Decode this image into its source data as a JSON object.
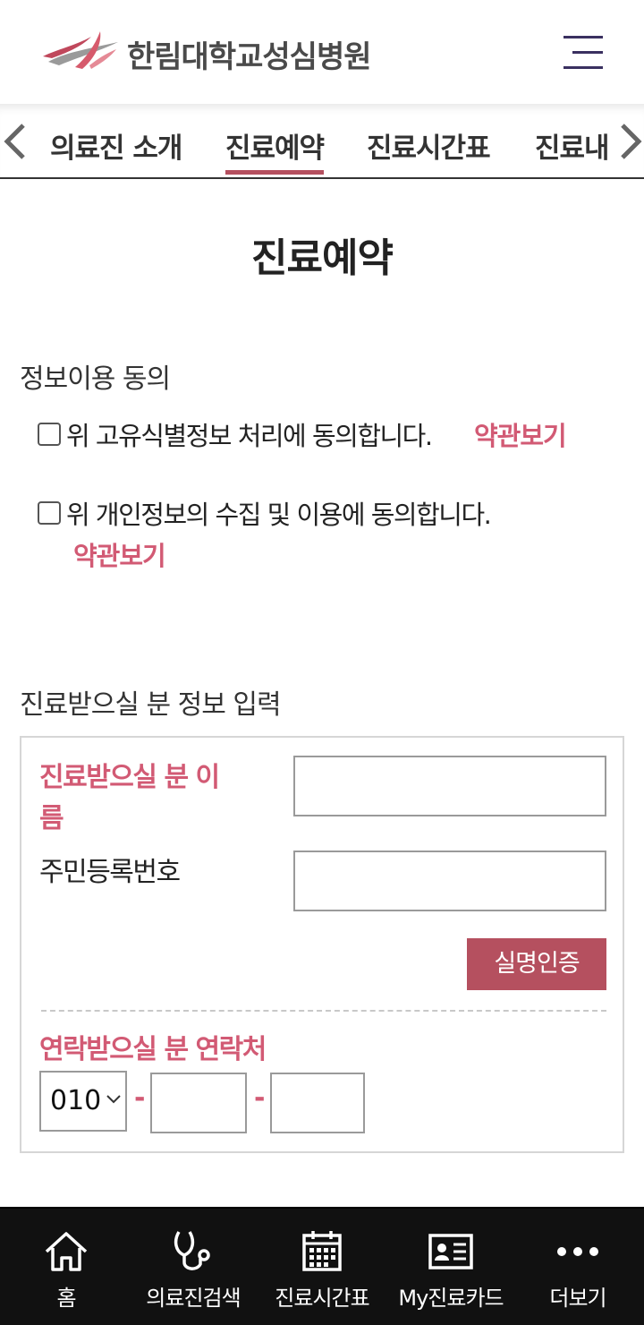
{
  "header": {
    "hospital_name": "한림대학교성심병원",
    "logo_icon": "hallym-logo-icon",
    "menu_icon": "hamburger-menu-icon"
  },
  "tabs": {
    "items": [
      {
        "label": "의료진 소개",
        "active": false
      },
      {
        "label": "진료예약",
        "active": true
      },
      {
        "label": "진료시간표",
        "active": false
      },
      {
        "label": "진료내",
        "active": false
      }
    ],
    "prev_icon": "chevron-left-icon",
    "next_icon": "chevron-right-icon",
    "active_color": "#b5505f"
  },
  "page_title": "진료예약",
  "consent": {
    "section_title": "정보이용 동의",
    "items": [
      {
        "text": "위 고유식별정보 처리에 동의합니다.",
        "link": "약관보기",
        "checked": false
      },
      {
        "text": "위 개인정보의 수집 및 이용에 동의합니다.",
        "link": "약관보기",
        "checked": false
      }
    ]
  },
  "patient_info": {
    "section_title": "진료받으실 분 정보 입력",
    "name_label_line1": "진료받으실 분 이",
    "name_label_line2": "름",
    "name_value": "",
    "rrn_label": "주민등록번호",
    "rrn_value": "",
    "verify_button": "실명인증",
    "contact_label": "연락받으실 분 연락처",
    "phone_prefix": "010",
    "phone_separator": "-",
    "phone_middle": "",
    "phone_last": ""
  },
  "colors": {
    "accent": "#b5505f",
    "link": "#d25a74",
    "nav_bg": "#111111"
  },
  "bottom_nav": {
    "items": [
      {
        "label": "홈",
        "icon": "home-icon"
      },
      {
        "label": "의료진검색",
        "icon": "stethoscope-icon"
      },
      {
        "label": "진료시간표",
        "icon": "calendar-icon"
      },
      {
        "label": "My진료카드",
        "icon": "id-card-icon"
      },
      {
        "label": "더보기",
        "icon": "more-dots-icon"
      }
    ]
  }
}
